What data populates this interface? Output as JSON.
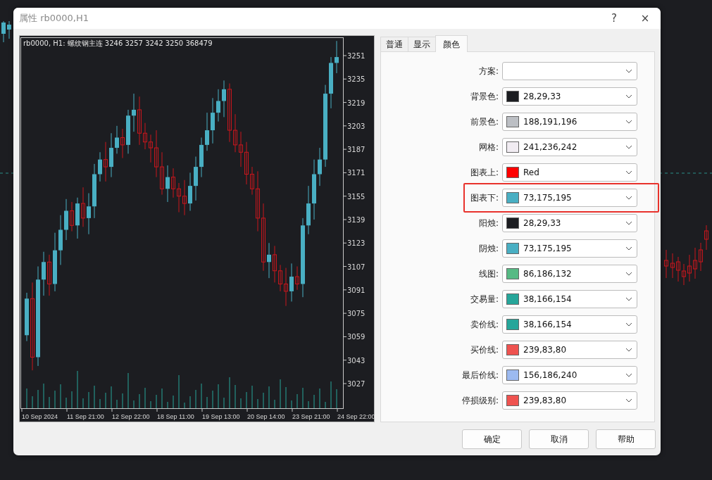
{
  "dialog": {
    "title": "属性 rb0000,H1",
    "help": "?",
    "close": "×"
  },
  "chart": {
    "header": "rb0000, H1: 螺纹钢主连  3246 3257 3242 3250  368479",
    "price_labels": [
      "3251",
      "3235",
      "3219",
      "3203",
      "3187",
      "3171",
      "3155",
      "3139",
      "3123",
      "3107",
      "3091",
      "3075",
      "3059",
      "3043",
      "3027"
    ],
    "time_labels": [
      "10 Sep 2024",
      "11 Sep 21:00",
      "12 Sep 22:00",
      "18 Sep 11:00",
      "19 Sep 13:00",
      "20 Sep 14:00",
      "23 Sep 21:00",
      "24 Sep 22:00"
    ]
  },
  "tabs": [
    {
      "label": "普通",
      "selected": false
    },
    {
      "label": "显示",
      "selected": false
    },
    {
      "label": "颜色",
      "selected": true
    }
  ],
  "color_rows": [
    {
      "label": "方案:",
      "highlighted": false
    },
    {
      "label": "背景色:",
      "value": "28,29,33",
      "color": "#1c1d21",
      "highlighted": false
    },
    {
      "label": "前景色:",
      "value": "188,191,196",
      "color": "#bcbfc4",
      "highlighted": false
    },
    {
      "label": "网格:",
      "value": "241,236,242",
      "color": "#f1ecf2",
      "highlighted": false
    },
    {
      "label": "图表上:",
      "value": "Red",
      "color": "#ff0000",
      "highlighted": false
    },
    {
      "label": "图表下:",
      "value": "73,175,195",
      "color": "#49afc3",
      "highlighted": true
    },
    {
      "label": "阳烛:",
      "value": "28,29,33",
      "color": "#1c1d21",
      "highlighted": false
    },
    {
      "label": "阴烛:",
      "value": "73,175,195",
      "color": "#49afc3",
      "highlighted": false
    },
    {
      "label": "线图:",
      "value": "86,186,132",
      "color": "#56ba84",
      "highlighted": false
    },
    {
      "label": "交易量:",
      "value": "38,166,154",
      "color": "#26a69a",
      "highlighted": false
    },
    {
      "label": "卖价线:",
      "value": "38,166,154",
      "color": "#26a69a",
      "highlighted": false
    },
    {
      "label": "买价线:",
      "value": "239,83,80",
      "color": "#ef5350",
      "highlighted": false
    },
    {
      "label": "最后价线:",
      "value": "156,186,240",
      "color": "#9cbaf0",
      "highlighted": false
    },
    {
      "label": "停损级别:",
      "value": "239,83,80",
      "color": "#ef5350",
      "highlighted": false
    }
  ],
  "buttons": [
    "确定",
    "取消",
    "帮助"
  ]
}
